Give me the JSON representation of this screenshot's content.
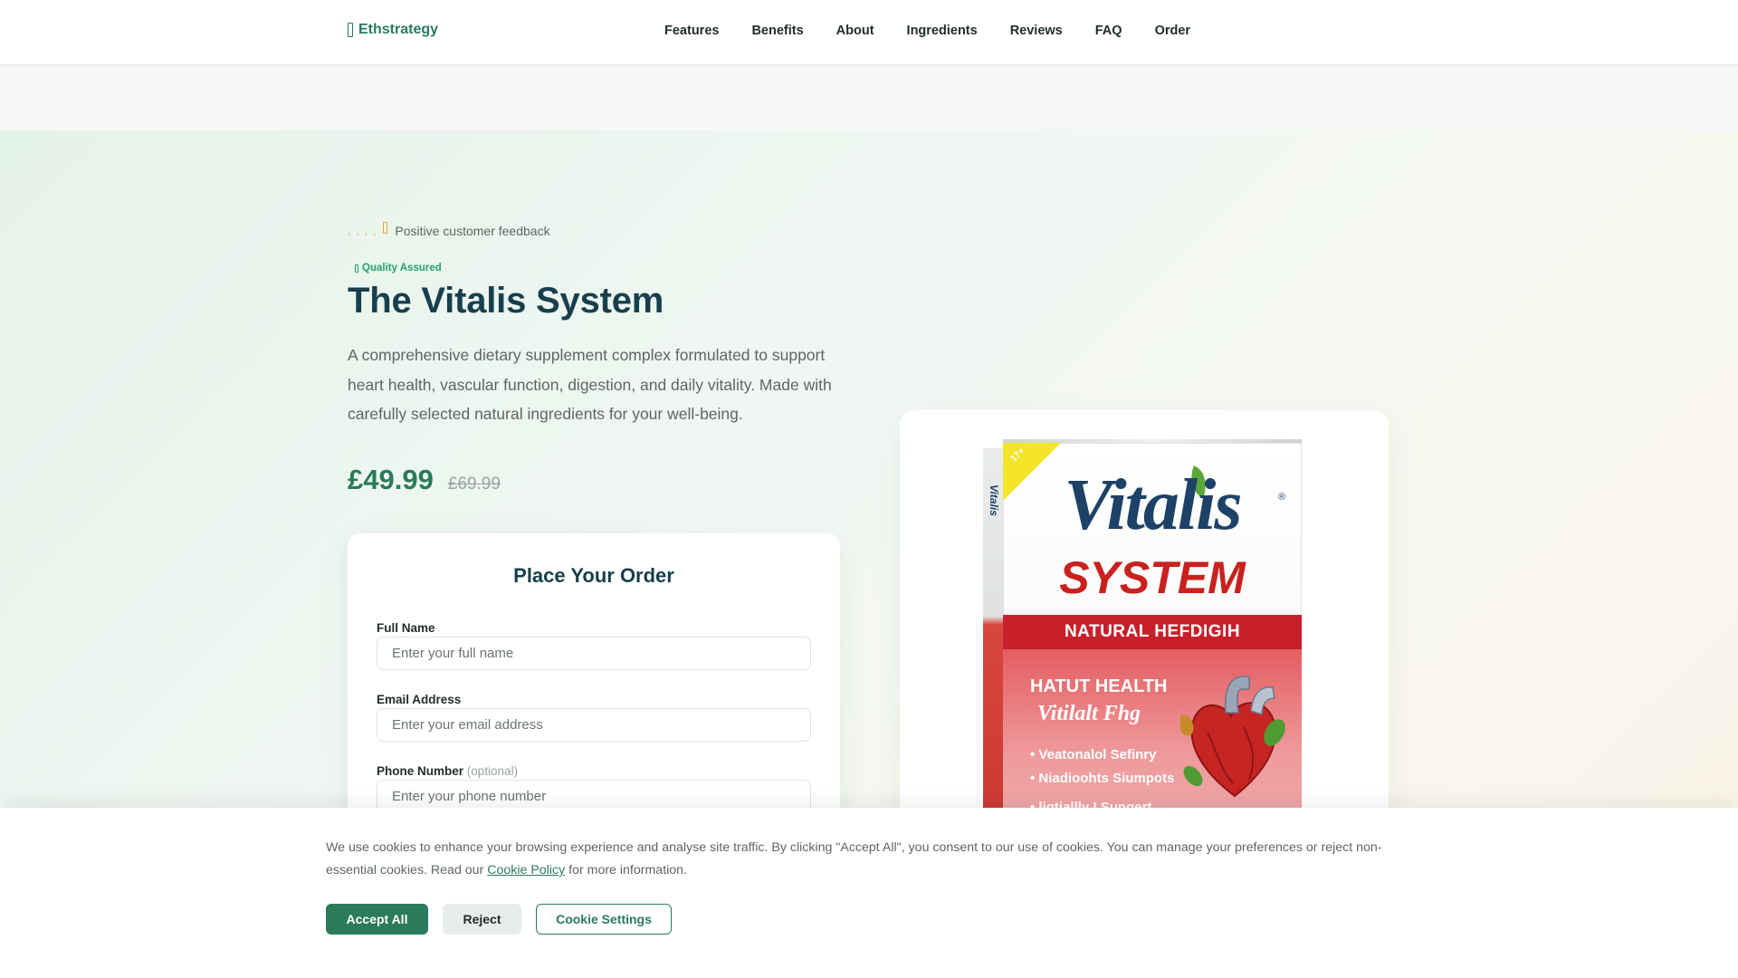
{
  "brand": {
    "name": "Ethstrategy",
    "icon": "leaf-icon",
    "color": "#2a7a5b"
  },
  "nav": {
    "items": [
      "Features",
      "Benefits",
      "About",
      "Ingredients",
      "Reviews",
      "FAQ",
      "Order"
    ]
  },
  "hero": {
    "rating_text": "Positive customer feedback",
    "rating_stars": 5,
    "badge": "Quality Assured",
    "title": "The Vitalis System",
    "description": "A comprehensive dietary supplement complex formulated to support heart health, vascular function, digestion, and daily vitality. Made with carefully selected natural ingredients for your well-being.",
    "price": "£49.99",
    "old_price": "£69.99"
  },
  "order_form": {
    "title": "Place Your Order",
    "full_name": {
      "label": "Full Name",
      "placeholder": "Enter your full name",
      "value": ""
    },
    "email": {
      "label": "Email Address",
      "placeholder": "Enter your email address",
      "value": ""
    },
    "phone": {
      "label": "Phone Number",
      "optional": "(optional)",
      "placeholder": "Enter your phone number",
      "value": ""
    }
  },
  "product": {
    "brand": "Vitalis",
    "reg_mark": "®",
    "sub_brand": "SYSTEM",
    "side_text": "Vitalis",
    "banner": "NATURAL HEFDIGIH",
    "line1": "HATUT HEALTH",
    "line2": "Vitilalt Fhg",
    "bullets": [
      "• Veatonalol Sefinry",
      "• Niadioohts Siumpots",
      "• ligtiallly I Sungert"
    ],
    "corner": "17+"
  },
  "cookie": {
    "text_before": "We use cookies to enhance your browsing experience and analyse site traffic. By clicking \"Accept All\", you consent to our use of cookies. You can manage your preferences or reject non-essential cookies. Read our ",
    "link": "Cookie Policy",
    "text_after": " for more information.",
    "accept": "Accept All",
    "reject": "Reject",
    "settings": "Cookie Settings"
  },
  "colors": {
    "accent": "#2a7a5b",
    "title": "#173f4d",
    "star": "#e7a928",
    "badge": "#22a46a"
  }
}
